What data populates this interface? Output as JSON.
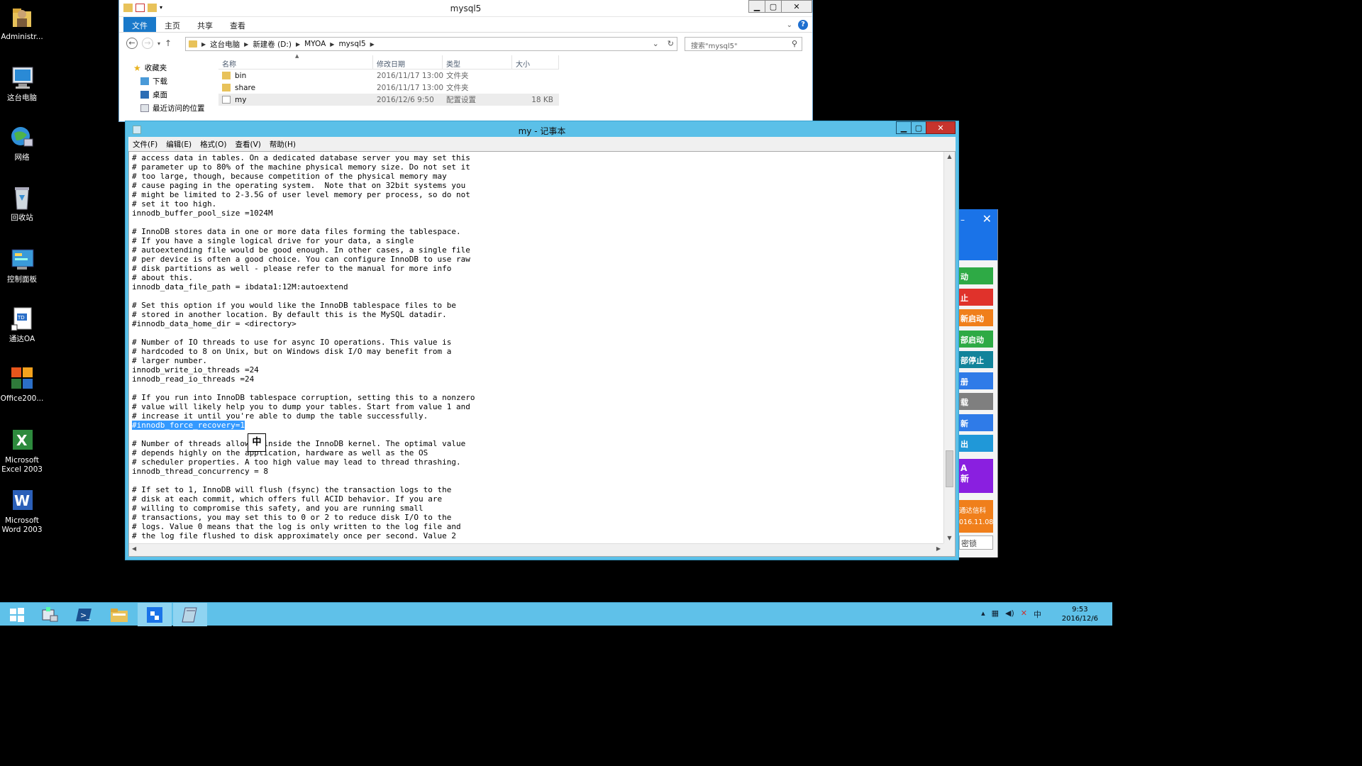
{
  "desktop": {
    "icons": [
      {
        "label": "Administr...",
        "icon": "user-folder-icon"
      },
      {
        "label": "这台电脑",
        "icon": "computer-icon"
      },
      {
        "label": "网络",
        "icon": "network-icon"
      },
      {
        "label": "回收站",
        "icon": "recycle-bin-icon"
      },
      {
        "label": "控制面板",
        "icon": "control-panel-icon"
      },
      {
        "label": "通达OA",
        "icon": "tongda-oa-icon"
      },
      {
        "label": "Office200...",
        "icon": "office-icon"
      },
      {
        "label": "Microsoft Excel 2003",
        "icon": "excel-icon"
      },
      {
        "label": "Microsoft Word 2003",
        "icon": "word-icon"
      }
    ]
  },
  "explorer": {
    "title": "mysql5",
    "ribbon_tabs": [
      "文件",
      "主页",
      "共享",
      "查看"
    ],
    "breadcrumb": [
      "这台电脑",
      "新建卷 (D:)",
      "MYOA",
      "mysql5"
    ],
    "search_placeholder": "搜索\"mysql5\"",
    "nav": {
      "favorites": "收藏夹",
      "items": [
        "下载",
        "桌面",
        "最近访问的位置"
      ]
    },
    "columns": [
      "名称",
      "修改日期",
      "类型",
      "大小"
    ],
    "files": [
      {
        "name": "bin",
        "date": "2016/11/17 13:00",
        "type": "文件夹",
        "size": ""
      },
      {
        "name": "share",
        "date": "2016/11/17 13:00",
        "type": "文件夹",
        "size": ""
      },
      {
        "name": "my",
        "date": "2016/12/6 9:50",
        "type": "配置设置",
        "size": "18 KB"
      }
    ]
  },
  "notepad": {
    "title": "my - 记事本",
    "menu": [
      "文件(F)",
      "编辑(E)",
      "格式(O)",
      "查看(V)",
      "帮助(H)"
    ],
    "lines_before": [
      "# access data in tables. On a dedicated database server you may set this",
      "# parameter up to 80% of the machine physical memory size. Do not set it",
      "# too large, though, because competition of the physical memory may",
      "# cause paging in the operating system.  Note that on 32bit systems you",
      "# might be limited to 2-3.5G of user level memory per process, so do not",
      "# set it too high.",
      "innodb_buffer_pool_size =1024M",
      "",
      "# InnoDB stores data in one or more data files forming the tablespace.",
      "# If you have a single logical drive for your data, a single",
      "# autoextending file would be good enough. In other cases, a single file",
      "# per device is often a good choice. You can configure InnoDB to use raw",
      "# disk partitions as well - please refer to the manual for more info",
      "# about this.",
      "innodb_data_file_path = ibdata1:12M:autoextend",
      "",
      "# Set this option if you would like the InnoDB tablespace files to be",
      "# stored in another location. By default this is the MySQL datadir.",
      "#innodb_data_home_dir = <directory>",
      "",
      "# Number of IO threads to use for async IO operations. This value is",
      "# hardcoded to 8 on Unix, but on Windows disk I/O may benefit from a",
      "# larger number.",
      "innodb_write_io_threads =24",
      "innodb_read_io_threads =24",
      "",
      "# If you run into InnoDB tablespace corruption, setting this to a nonzero",
      "# value will likely help you to dump your tables. Start from value 1 and",
      "# increase it until you're able to dump the table successfully."
    ],
    "selected_line": "#innodb_force_recovery=1",
    "lines_after": [
      "",
      "# Number of threads allowed inside the InnoDB kernel. The optimal value",
      "# depends highly on the application, hardware as well as the OS",
      "# scheduler properties. A too high value may lead to thread thrashing.",
      "innodb_thread_concurrency = 8",
      "",
      "# If set to 1, InnoDB will flush (fsync) the transaction logs to the",
      "# disk at each commit, which offers full ACID behavior. If you are",
      "# willing to compromise this safety, and you are running small",
      "# transactions, you may set this to 0 or 2 to reduce disk I/O to the",
      "# logs. Value 0 means that the log is only written to the log file and",
      "# the log file flushed to disk approximately once per second. Value 2"
    ],
    "ime_indicator": "中"
  },
  "side_panel": {
    "buttons": [
      {
        "label": "动",
        "color": "#2eaa45"
      },
      {
        "label": "止",
        "color": "#e0322b"
      },
      {
        "label": "新启动",
        "color": "#f07f1b"
      },
      {
        "label": "部启动",
        "color": "#2eaa45"
      },
      {
        "label": "部停止",
        "color": "#12839a"
      },
      {
        "label": "册",
        "color": "#2f7be8"
      },
      {
        "label": "载",
        "color": "#7f7f7f"
      },
      {
        "label": "新",
        "color": "#2f7be8"
      },
      {
        "label": "出",
        "color": "#2098d8"
      }
    ],
    "purple_line1": "A",
    "purple_line2": "新",
    "orange_line1": "通达信科",
    "orange_line2": "016.11.08",
    "footer": "密锁"
  },
  "taskbar": {
    "clock_time": "9:53",
    "clock_date": "2016/12/6",
    "ime": "中"
  }
}
